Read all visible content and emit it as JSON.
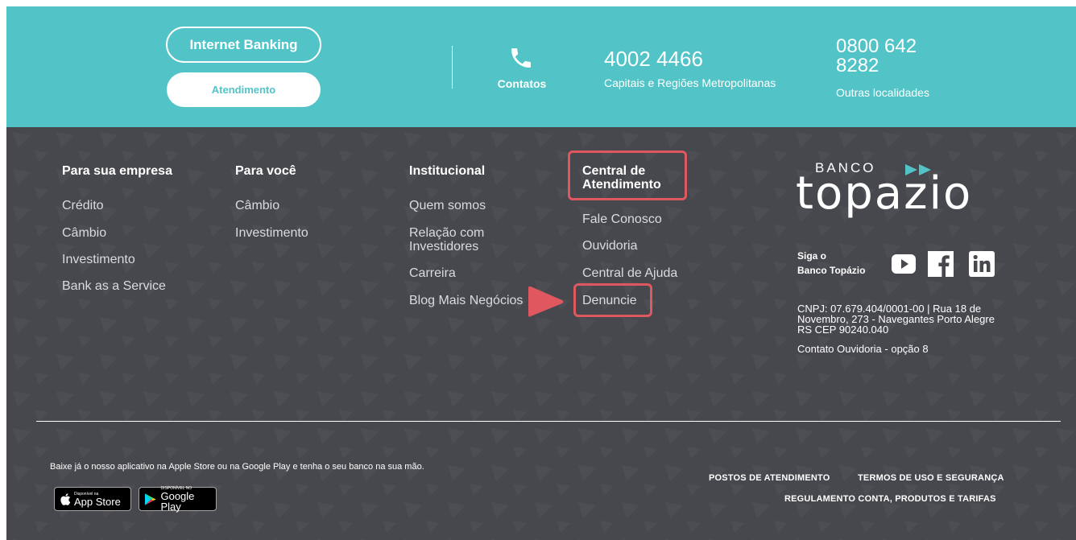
{
  "header": {
    "internet_banking_label": "Internet Banking",
    "atendimento_label": "Atendimento",
    "contatos_label": "Contatos",
    "phone1": "4002 4466",
    "phone1_desc": "Capitais e Regiões Metropolitanas",
    "phone2": "0800 642 8282",
    "phone2_desc": "Outras localidades"
  },
  "columns": [
    {
      "title": "Para sua empresa",
      "links": [
        "Crédito",
        "Câmbio",
        "Investimento",
        "Bank as a Service"
      ]
    },
    {
      "title": "Para você",
      "links": [
        "Câmbio",
        "Investimento"
      ]
    },
    {
      "title": "Institucional",
      "links": [
        "Quem somos",
        "Relação com Investidores",
        "Carreira",
        "Blog Mais Negócios"
      ]
    },
    {
      "title": "Central de Atendimento",
      "links": [
        "Fale Conosco",
        "Ouvidoria",
        "Central de Ajuda",
        "Denuncie"
      ]
    }
  ],
  "brand": {
    "banco": "BANCO",
    "name": "topazio",
    "follow_line1": "Siga o",
    "follow_line2": "Banco Topázio",
    "social_icons": [
      "youtube-icon",
      "facebook-icon",
      "linkedin-icon"
    ],
    "address": "CNPJ: 07.679.404/0001-00 | Rua 18 de Novembro, 273 - Navegantes Porto Alegre RS CEP 90240.040",
    "ouvidoria_contact": "Contato Ouvidoria - opção 8"
  },
  "bottom": {
    "app_text": "Baixe já o nosso aplicativo na Apple Store ou na Google Play e tenha o seu banco na sua mão.",
    "app_store_small": "Disponível na",
    "app_store_big": "App Store",
    "google_play_small": "DISPONÍVEL NO",
    "google_play_big": "Google Play",
    "postos": "POSTOS DE ATENDIMENTO",
    "termos": "TERMOS DE USO E SEGURANÇA",
    "regulamento": "REGULAMENTO CONTA, PRODUTOS E TARIFAS"
  },
  "colors": {
    "teal": "#52c4c7",
    "footer_bg": "#47484d",
    "highlight": "#e0585f"
  }
}
